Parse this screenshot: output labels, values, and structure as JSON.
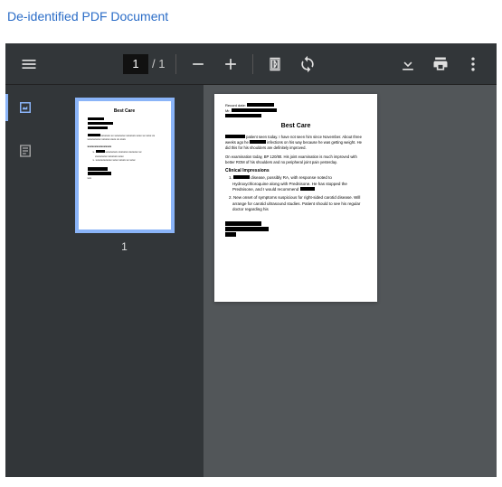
{
  "header": {
    "link_text": "De-identified PDF Document"
  },
  "toolbar": {
    "page_current": "1",
    "page_total": "1"
  },
  "thumbnail": {
    "label": "1"
  },
  "document": {
    "title": "Best Care",
    "section_impressions": "Clinical Impressions",
    "para1": "patient seen today. I have not seen him since November. About three weeks ago he",
    "para1b": "infections on his way because he was getting weight. He did this for his shoulders are definitely improved.",
    "para2": "On examination today, BP 120/80. His joint examination is much improved with better ROM of his shoulders and no peripheral joint pain yesterday.",
    "imp1": "disease, possibly RA, with response noted to Hydroxychloroquine along with Prednisone. He has stopped the Prednisone, and I would recommend",
    "imp2": "New onset of symptoms suspicious for right-sided carotid disease. Will arrange for carotid ultrasound studies. Patient should to see his regular doctor regarding his"
  }
}
